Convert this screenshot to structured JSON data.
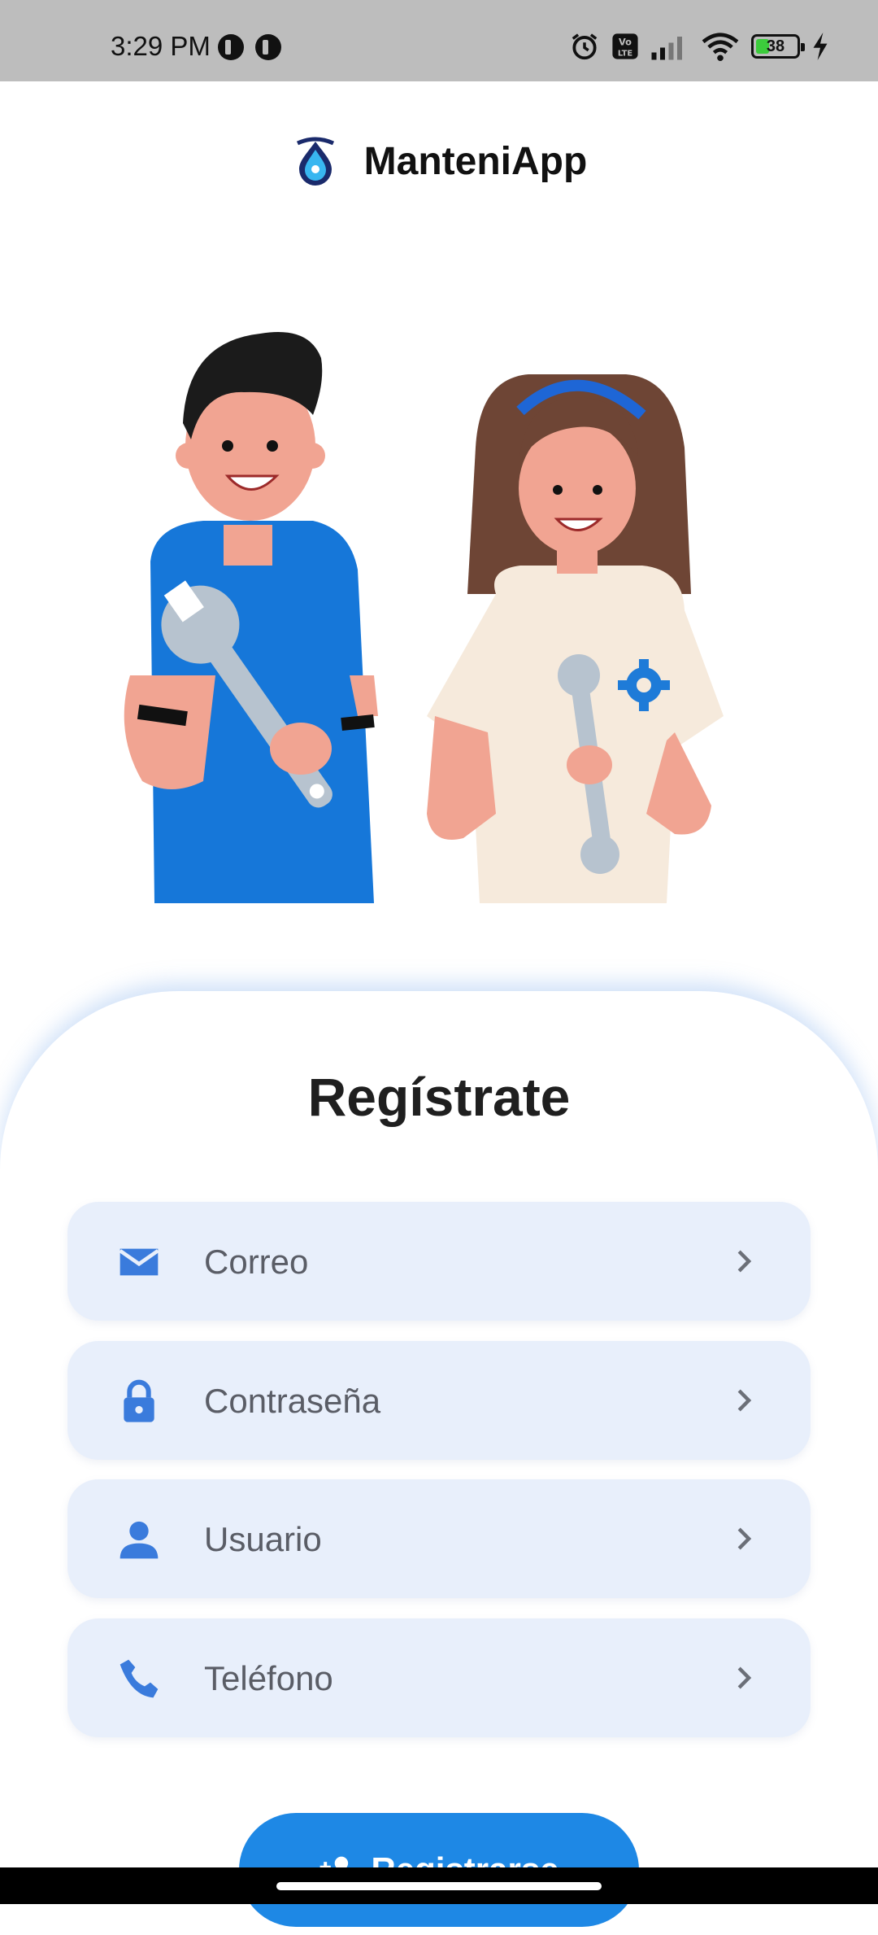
{
  "status_bar": {
    "time": "3:29 PM",
    "battery_level": "38",
    "icons": [
      "notification-icon",
      "notification-icon",
      "alarm-icon",
      "volte-icon",
      "signal-icon",
      "wifi-icon",
      "battery-icon",
      "charging-icon"
    ]
  },
  "header": {
    "app_name": "ManteniApp",
    "logo_icon": "droplet-logo-icon"
  },
  "illustration": {
    "icon": "mechanics-illustration"
  },
  "form": {
    "title": "Regístrate",
    "fields": [
      {
        "label": "Correo",
        "icon": "mail-icon"
      },
      {
        "label": "Contraseña",
        "icon": "lock-icon"
      },
      {
        "label": "Usuario",
        "icon": "person-icon"
      },
      {
        "label": "Teléfono",
        "icon": "phone-icon"
      }
    ],
    "submit_label": "Registrarse",
    "submit_icon": "person-add-icon"
  },
  "colors": {
    "accent": "#1e88e5",
    "field_bg": "#e8effb",
    "icon_blue": "#3a7bdc",
    "status_bar_bg": "#bdbdbd"
  }
}
